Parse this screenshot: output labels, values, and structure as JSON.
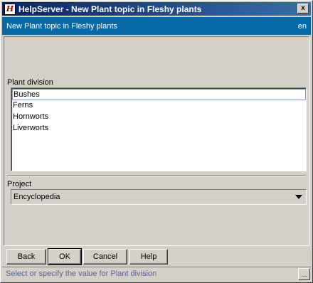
{
  "window": {
    "app_icon_glyph": "H",
    "title": "HelpServer - New Plant topic in Fleshy plants",
    "close_glyph": "x"
  },
  "header": {
    "subtitle": "New Plant topic in Fleshy plants",
    "lang": "en",
    "band_color": "#0869a8"
  },
  "plant_division": {
    "label": "Plant division",
    "items": [
      {
        "label": "Bushes",
        "selected": true
      },
      {
        "label": "Ferns",
        "selected": false
      },
      {
        "label": "Hornworts",
        "selected": false
      },
      {
        "label": "Liverworts",
        "selected": false
      }
    ]
  },
  "project": {
    "label": "Project",
    "selected_value": "Encyclopedia"
  },
  "buttons": {
    "back": "Back",
    "ok": "OK",
    "cancel": "Cancel",
    "help": "Help"
  },
  "status": {
    "text": "Select or specify the value for Plant division",
    "more_label": "..."
  }
}
